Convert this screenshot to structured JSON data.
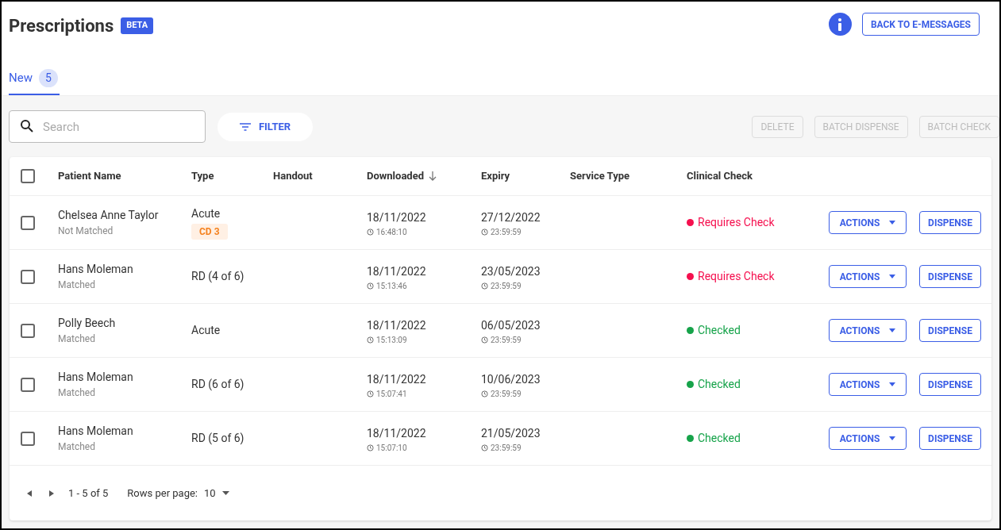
{
  "header": {
    "title": "Prescriptions",
    "badge": "BETA",
    "back_button": "BACK TO E-MESSAGES"
  },
  "tabs": [
    {
      "label": "New",
      "count": "5",
      "selected": true
    }
  ],
  "toolbar": {
    "search": {
      "placeholder": "Search"
    },
    "filter_button": "FILTER",
    "buttons": [
      {
        "label": "DELETE",
        "disabled": true
      },
      {
        "label": "BATCH DISPENSE",
        "disabled": true
      },
      {
        "label": "BATCH CHECK",
        "disabled": true
      }
    ]
  },
  "table": {
    "select_all": {
      "checked": false
    },
    "columns": [
      {
        "label": "Patient Name"
      },
      {
        "label": "Type"
      },
      {
        "label": "Handout"
      },
      {
        "label": "Downloaded",
        "sorted": true
      },
      {
        "label": "Expiry"
      },
      {
        "label": "Service Type"
      },
      {
        "label": "Clinical Check"
      }
    ],
    "rows": [
      {
        "checked": false,
        "name": "Chelsea Anne Taylor",
        "match": "Not Matched",
        "type": "Acute",
        "tag": "CD 3",
        "downloaded_date": "18/11/2022",
        "downloaded_time": "16:48:10",
        "expiry_date": "27/12/2022",
        "expiry_time": "23:59:59",
        "status": "Requires Check",
        "color": "#f50f4e",
        "actions": "ACTIONS",
        "dispense": "DISPENSE"
      },
      {
        "checked": false,
        "name": "Hans Moleman",
        "match": "Matched",
        "type": "RD (4 of 6)",
        "downloaded_date": "18/11/2022",
        "downloaded_time": "15:13:46",
        "expiry_date": "23/05/2023",
        "expiry_time": "23:59:59",
        "status": "Requires Check",
        "color": "#f50f4e",
        "actions": "ACTIONS",
        "dispense": "DISPENSE"
      },
      {
        "checked": false,
        "name": "Polly Beech",
        "match": "Matched",
        "type": "Acute",
        "downloaded_date": "18/11/2022",
        "downloaded_time": "15:13:09",
        "expiry_date": "06/05/2023",
        "expiry_time": "23:59:59",
        "status": "Checked",
        "color": "#16a34a",
        "actions": "ACTIONS",
        "dispense": "DISPENSE"
      },
      {
        "checked": false,
        "name": "Hans Moleman",
        "match": "Matched",
        "type": "RD (6 of 6)",
        "downloaded_date": "18/11/2022",
        "downloaded_time": "15:07:41",
        "expiry_date": "10/06/2023",
        "expiry_time": "23:59:59",
        "status": "Checked",
        "color": "#16a34a",
        "actions": "ACTIONS",
        "dispense": "DISPENSE"
      },
      {
        "checked": false,
        "name": "Hans Moleman",
        "match": "Matched",
        "type": "RD (5 of 6)",
        "downloaded_date": "18/11/2022",
        "downloaded_time": "15:07:10",
        "expiry_date": "21/05/2023",
        "expiry_time": "23:59:59",
        "status": "Checked",
        "color": "#16a34a",
        "actions": "ACTIONS",
        "dispense": "DISPENSE"
      }
    ]
  },
  "pagination": {
    "range": "1 - 5 of 5",
    "rows_label": "Rows per page:",
    "rows_value": "10"
  }
}
